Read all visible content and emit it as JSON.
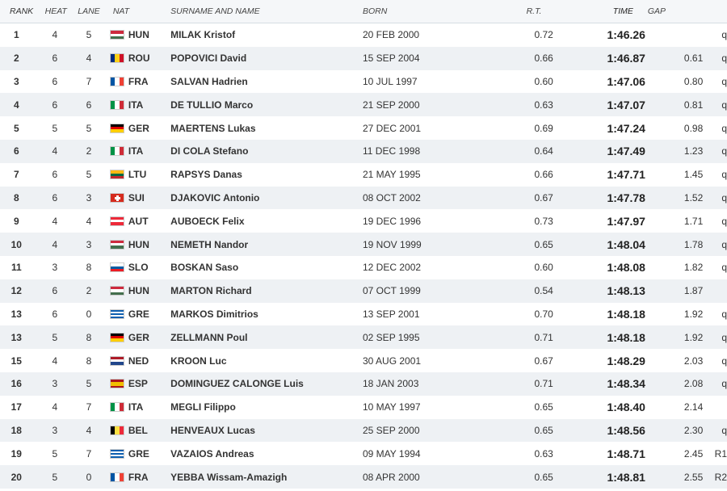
{
  "headers": {
    "rank": "RANK",
    "heat": "HEAT",
    "lane": "LANE",
    "nat": "NAT",
    "name": "SURNAME AND NAME",
    "born": "BORN",
    "rt": "R.T.",
    "time": "TIME",
    "gap": "GAP"
  },
  "flags": {
    "HUN": {
      "dir": "h",
      "colors": [
        "#cd2a3e",
        "#ffffff",
        "#436f4d"
      ]
    },
    "ROU": {
      "dir": "v",
      "colors": [
        "#002b7f",
        "#fcd116",
        "#ce1126"
      ]
    },
    "FRA": {
      "dir": "v",
      "colors": [
        "#0055a4",
        "#ffffff",
        "#ef4135"
      ]
    },
    "ITA": {
      "dir": "v",
      "colors": [
        "#009246",
        "#ffffff",
        "#ce2b37"
      ]
    },
    "GER": {
      "dir": "h",
      "colors": [
        "#000000",
        "#dd0000",
        "#ffce00"
      ]
    },
    "LTU": {
      "dir": "h",
      "colors": [
        "#fdb913",
        "#006a44",
        "#c1272d"
      ]
    },
    "SUI": {
      "dir": "cross",
      "colors": [
        "#d52b1e",
        "#ffffff"
      ]
    },
    "AUT": {
      "dir": "h",
      "colors": [
        "#ed2939",
        "#ffffff",
        "#ed2939"
      ]
    },
    "SLO": {
      "dir": "h",
      "colors": [
        "#ffffff",
        "#005da4",
        "#ed1c24"
      ]
    },
    "GRE": {
      "dir": "stripes",
      "colors": [
        "#0d5eaf",
        "#ffffff"
      ]
    },
    "NED": {
      "dir": "h",
      "colors": [
        "#ae1c28",
        "#ffffff",
        "#21468b"
      ]
    },
    "ESP": {
      "dir": "esp",
      "colors": [
        "#aa151b",
        "#f1bf00",
        "#aa151b"
      ]
    },
    "BEL": {
      "dir": "v",
      "colors": [
        "#000000",
        "#fae042",
        "#ed2939"
      ]
    }
  },
  "rows": [
    {
      "rank": "1",
      "heat": "4",
      "lane": "5",
      "nat": "HUN",
      "name": "MILAK Kristof",
      "born": "20 FEB 2000",
      "rt": "0.72",
      "time": "1:46.26",
      "gap": "",
      "q": "q"
    },
    {
      "rank": "2",
      "heat": "6",
      "lane": "4",
      "nat": "ROU",
      "name": "POPOVICI David",
      "born": "15 SEP 2004",
      "rt": "0.66",
      "time": "1:46.87",
      "gap": "0.61",
      "q": "q"
    },
    {
      "rank": "3",
      "heat": "6",
      "lane": "7",
      "nat": "FRA",
      "name": "SALVAN Hadrien",
      "born": "10 JUL 1997",
      "rt": "0.60",
      "time": "1:47.06",
      "gap": "0.80",
      "q": "q"
    },
    {
      "rank": "4",
      "heat": "6",
      "lane": "6",
      "nat": "ITA",
      "name": "DE TULLIO Marco",
      "born": "21 SEP 2000",
      "rt": "0.63",
      "time": "1:47.07",
      "gap": "0.81",
      "q": "q"
    },
    {
      "rank": "5",
      "heat": "5",
      "lane": "5",
      "nat": "GER",
      "name": "MAERTENS Lukas",
      "born": "27 DEC 2001",
      "rt": "0.69",
      "time": "1:47.24",
      "gap": "0.98",
      "q": "q"
    },
    {
      "rank": "6",
      "heat": "4",
      "lane": "2",
      "nat": "ITA",
      "name": "DI COLA Stefano",
      "born": "11 DEC 1998",
      "rt": "0.64",
      "time": "1:47.49",
      "gap": "1.23",
      "q": "q"
    },
    {
      "rank": "7",
      "heat": "6",
      "lane": "5",
      "nat": "LTU",
      "name": "RAPSYS Danas",
      "born": "21 MAY 1995",
      "rt": "0.66",
      "time": "1:47.71",
      "gap": "1.45",
      "q": "q"
    },
    {
      "rank": "8",
      "heat": "6",
      "lane": "3",
      "nat": "SUI",
      "name": "DJAKOVIC Antonio",
      "born": "08 OCT 2002",
      "rt": "0.67",
      "time": "1:47.78",
      "gap": "1.52",
      "q": "q"
    },
    {
      "rank": "9",
      "heat": "4",
      "lane": "4",
      "nat": "AUT",
      "name": "AUBOECK Felix",
      "born": "19 DEC 1996",
      "rt": "0.73",
      "time": "1:47.97",
      "gap": "1.71",
      "q": "q"
    },
    {
      "rank": "10",
      "heat": "4",
      "lane": "3",
      "nat": "HUN",
      "name": "NEMETH Nandor",
      "born": "19 NOV 1999",
      "rt": "0.65",
      "time": "1:48.04",
      "gap": "1.78",
      "q": "q"
    },
    {
      "rank": "11",
      "heat": "3",
      "lane": "8",
      "nat": "SLO",
      "name": "BOSKAN Saso",
      "born": "12 DEC 2002",
      "rt": "0.60",
      "time": "1:48.08",
      "gap": "1.82",
      "q": "q"
    },
    {
      "rank": "12",
      "heat": "6",
      "lane": "2",
      "nat": "HUN",
      "name": "MARTON Richard",
      "born": "07 OCT 1999",
      "rt": "0.54",
      "time": "1:48.13",
      "gap": "1.87",
      "q": ""
    },
    {
      "rank": "13",
      "heat": "6",
      "lane": "0",
      "nat": "GRE",
      "name": "MARKOS Dimitrios",
      "born": "13 SEP 2001",
      "rt": "0.70",
      "time": "1:48.18",
      "gap": "1.92",
      "q": "q"
    },
    {
      "rank": "13",
      "heat": "5",
      "lane": "8",
      "nat": "GER",
      "name": "ZELLMANN Poul",
      "born": "02 SEP 1995",
      "rt": "0.71",
      "time": "1:48.18",
      "gap": "1.92",
      "q": "q"
    },
    {
      "rank": "15",
      "heat": "4",
      "lane": "8",
      "nat": "NED",
      "name": "KROON Luc",
      "born": "30 AUG 2001",
      "rt": "0.67",
      "time": "1:48.29",
      "gap": "2.03",
      "q": "q"
    },
    {
      "rank": "16",
      "heat": "3",
      "lane": "5",
      "nat": "ESP",
      "name": "DOMINGUEZ CALONGE Luis",
      "born": "18 JAN 2003",
      "rt": "0.71",
      "time": "1:48.34",
      "gap": "2.08",
      "q": "q"
    },
    {
      "rank": "17",
      "heat": "4",
      "lane": "7",
      "nat": "ITA",
      "name": "MEGLI Filippo",
      "born": "10 MAY 1997",
      "rt": "0.65",
      "time": "1:48.40",
      "gap": "2.14",
      "q": ""
    },
    {
      "rank": "18",
      "heat": "3",
      "lane": "4",
      "nat": "BEL",
      "name": "HENVEAUX Lucas",
      "born": "25 SEP 2000",
      "rt": "0.65",
      "time": "1:48.56",
      "gap": "2.30",
      "q": "q"
    },
    {
      "rank": "19",
      "heat": "5",
      "lane": "7",
      "nat": "GRE",
      "name": "VAZAIOS Andreas",
      "born": "09 MAY 1994",
      "rt": "0.63",
      "time": "1:48.71",
      "gap": "2.45",
      "q": "R1"
    },
    {
      "rank": "20",
      "heat": "5",
      "lane": "0",
      "nat": "FRA",
      "name": "YEBBA Wissam-Amazigh",
      "born": "08 APR 2000",
      "rt": "0.65",
      "time": "1:48.81",
      "gap": "2.55",
      "q": "R2"
    }
  ]
}
